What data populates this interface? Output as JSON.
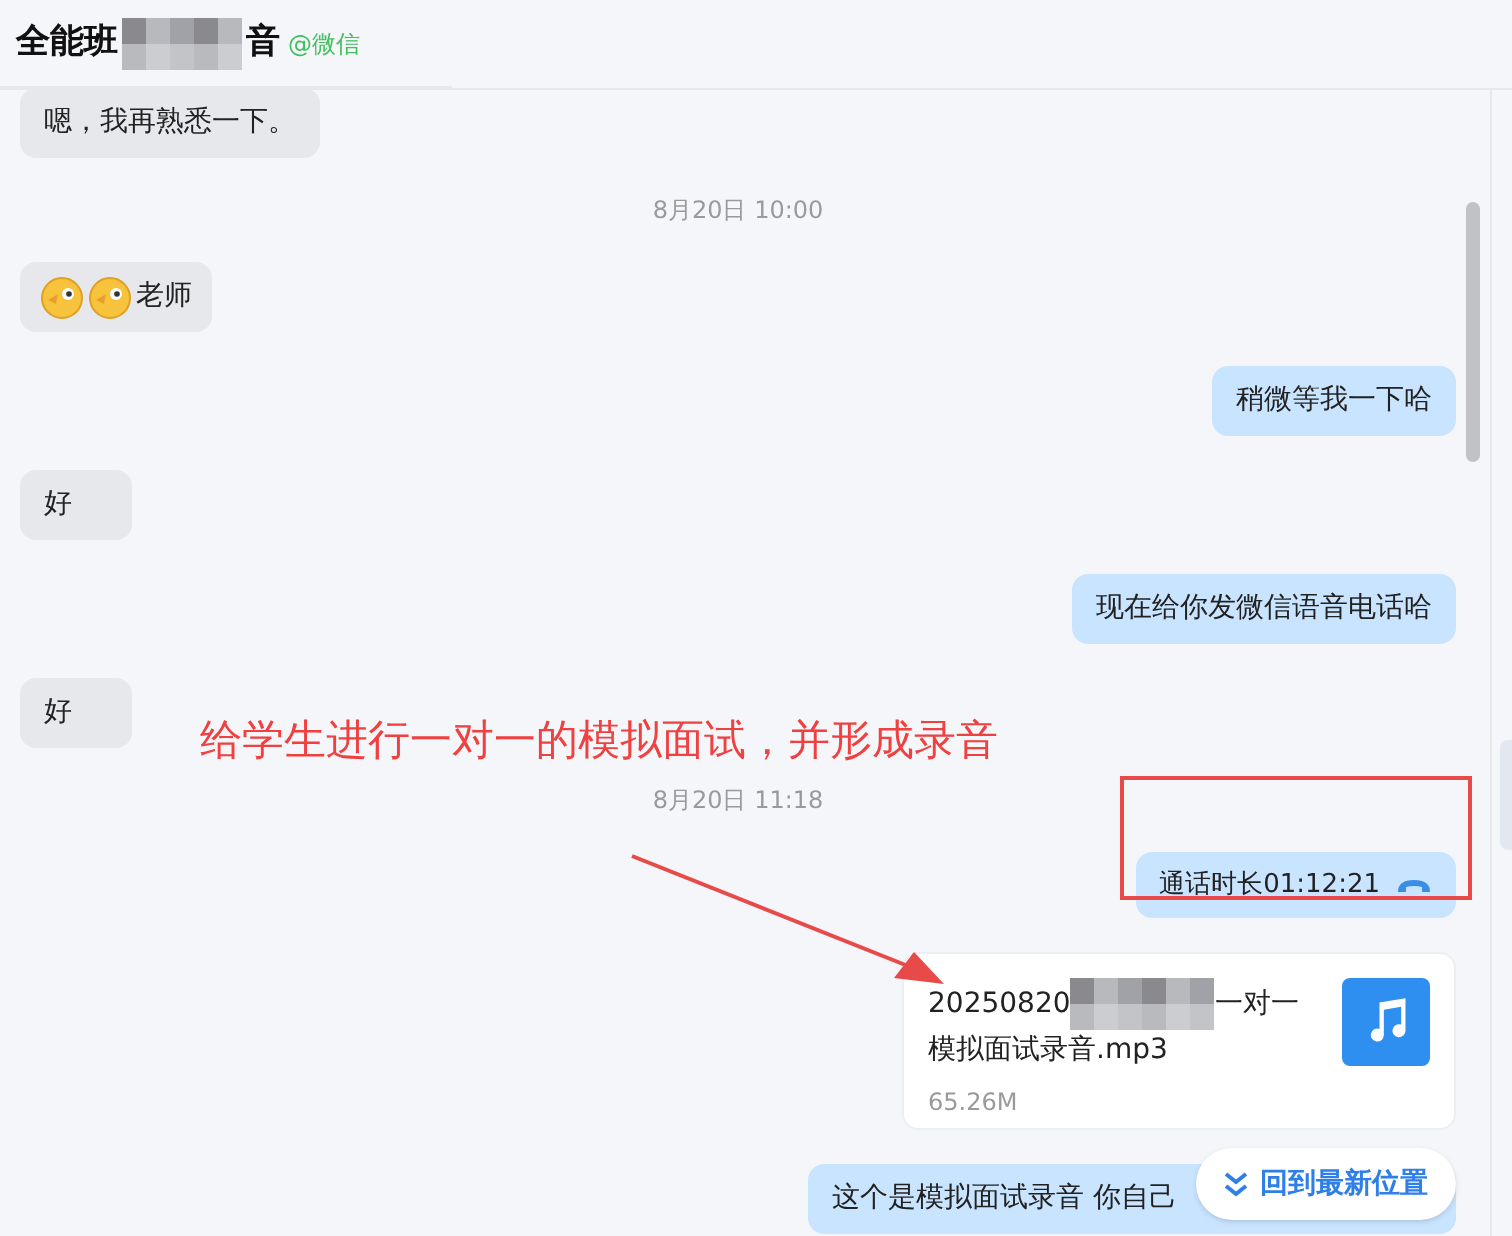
{
  "header": {
    "title_start": "全能班",
    "title_end": "音",
    "source": "@微信"
  },
  "messages": [
    {
      "kind": "text",
      "from_me": false,
      "text": "嗯，我再熟悉一下。"
    },
    {
      "kind": "time",
      "text": "8月20日 10:00"
    },
    {
      "kind": "emoji_text",
      "from_me": false,
      "text": "老师"
    },
    {
      "kind": "text",
      "from_me": true,
      "text": "稍微等我一下哈"
    },
    {
      "kind": "text",
      "from_me": false,
      "text": "好"
    },
    {
      "kind": "text",
      "from_me": true,
      "text": "现在给你发微信语音电话哈"
    },
    {
      "kind": "text",
      "from_me": false,
      "text": "好"
    },
    {
      "kind": "time",
      "text": "8月20日 11:18"
    },
    {
      "kind": "call",
      "from_me": true,
      "text": "通话时长01:12:21"
    },
    {
      "kind": "file",
      "from_me": true,
      "name_start": "20250820",
      "name_end": "一对一",
      "name_line2": "模拟面试录音.mp3",
      "size": "65.26M"
    },
    {
      "kind": "covered_text",
      "from_me": true,
      "text": "这个是模拟面试录音 你自己"
    }
  ],
  "jump_button": {
    "label": "回到最新位置"
  },
  "annotation": {
    "text": "给学生进行一对一的模拟面试，并形成录音"
  }
}
